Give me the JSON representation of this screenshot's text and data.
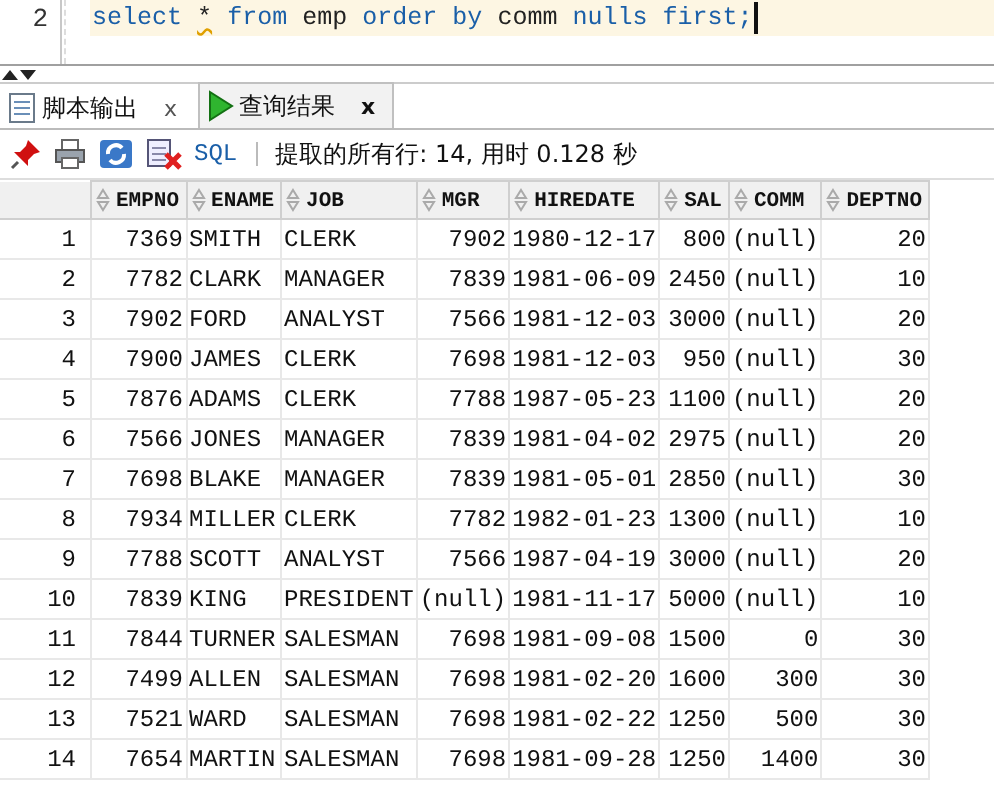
{
  "editor": {
    "line_number": "2",
    "tokens": [
      {
        "kind": "keyword",
        "text": "select"
      },
      {
        "kind": "warning",
        "text": "*"
      },
      {
        "kind": "keyword",
        "text": "from"
      },
      {
        "kind": "ident",
        "text": "emp"
      },
      {
        "kind": "keyword",
        "text": "order"
      },
      {
        "kind": "keyword",
        "text": "by"
      },
      {
        "kind": "ident",
        "text": "comm"
      },
      {
        "kind": "keyword",
        "text": "nulls"
      },
      {
        "kind": "keyword",
        "text": "first;"
      }
    ]
  },
  "tabs": [
    {
      "label": "脚本输出",
      "selected": false,
      "close": "x"
    },
    {
      "label": "查询结果",
      "selected": true,
      "close": "x"
    }
  ],
  "toolbar": {
    "sql_link": "SQL",
    "status": "提取的所有行: 14, 用时 0.128 秒"
  },
  "table": {
    "columns": [
      "",
      "EMPNO",
      "ENAME",
      "JOB",
      "MGR",
      "HIREDATE",
      "SAL",
      "COMM",
      "DEPTNO"
    ],
    "rows": [
      [
        "1",
        "7369",
        "SMITH",
        "CLERK",
        "7902",
        "1980-12-17",
        "800",
        "(null)",
        "20"
      ],
      [
        "2",
        "7782",
        "CLARK",
        "MANAGER",
        "7839",
        "1981-06-09",
        "2450",
        "(null)",
        "10"
      ],
      [
        "3",
        "7902",
        "FORD",
        "ANALYST",
        "7566",
        "1981-12-03",
        "3000",
        "(null)",
        "20"
      ],
      [
        "4",
        "7900",
        "JAMES",
        "CLERK",
        "7698",
        "1981-12-03",
        "950",
        "(null)",
        "30"
      ],
      [
        "5",
        "7876",
        "ADAMS",
        "CLERK",
        "7788",
        "1987-05-23",
        "1100",
        "(null)",
        "20"
      ],
      [
        "6",
        "7566",
        "JONES",
        "MANAGER",
        "7839",
        "1981-04-02",
        "2975",
        "(null)",
        "20"
      ],
      [
        "7",
        "7698",
        "BLAKE",
        "MANAGER",
        "7839",
        "1981-05-01",
        "2850",
        "(null)",
        "30"
      ],
      [
        "8",
        "7934",
        "MILLER",
        "CLERK",
        "7782",
        "1982-01-23",
        "1300",
        "(null)",
        "10"
      ],
      [
        "9",
        "7788",
        "SCOTT",
        "ANALYST",
        "7566",
        "1987-04-19",
        "3000",
        "(null)",
        "20"
      ],
      [
        "10",
        "7839",
        "KING",
        "PRESIDENT",
        "(null)",
        "1981-11-17",
        "5000",
        "(null)",
        "10"
      ],
      [
        "11",
        "7844",
        "TURNER",
        "SALESMAN",
        "7698",
        "1981-09-08",
        "1500",
        "0",
        "30"
      ],
      [
        "12",
        "7499",
        "ALLEN",
        "SALESMAN",
        "7698",
        "1981-02-20",
        "1600",
        "300",
        "30"
      ],
      [
        "13",
        "7521",
        "WARD",
        "SALESMAN",
        "7698",
        "1981-02-22",
        "1250",
        "500",
        "30"
      ],
      [
        "14",
        "7654",
        "MARTIN",
        "SALESMAN",
        "7698",
        "1981-09-28",
        "1250",
        "1400",
        "30"
      ]
    ]
  }
}
